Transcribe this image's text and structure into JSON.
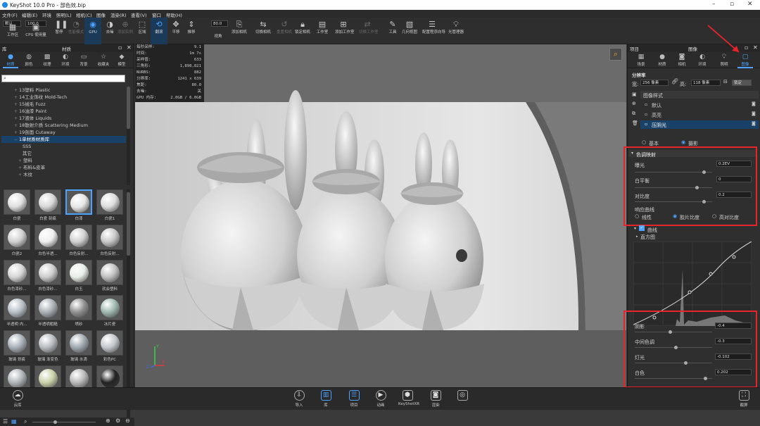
{
  "app": {
    "title": "KeyShot 10.0 Pro - 部色效.bip"
  },
  "menu": [
    "文件(F)",
    "编辑(E)",
    "环境",
    "照明(L)",
    "相机(C)",
    "图像",
    "渲染(R)",
    "查看(V)",
    "窗口",
    "帮助(H)"
  ],
  "toolbar": {
    "preset_value": "默认",
    "percent_value": "100.0",
    "quality_value": "80.0",
    "items": [
      {
        "label": "工作区",
        "icon": "workspace-icon"
      },
      {
        "label": "CPU 使用量",
        "icon": "cpu-icon"
      },
      {
        "label": "暂停",
        "icon": "pause-icon"
      },
      {
        "label": "性能模式",
        "icon": "performance-icon"
      },
      {
        "label": "GPU",
        "icon": "gpu-icon"
      },
      {
        "label": "去噪",
        "icon": "denoise-icon"
      },
      {
        "label": "添加实例",
        "icon": "add-instance-icon"
      },
      {
        "label": "区域",
        "icon": "region-icon"
      },
      {
        "label": "翻滚",
        "icon": "tumble-icon"
      },
      {
        "label": "平移",
        "icon": "pan-icon"
      },
      {
        "label": "推移",
        "icon": "dolly-icon"
      },
      {
        "label": "视角",
        "icon": "perspective-icon"
      },
      {
        "label": "添加相机",
        "icon": "add-camera-icon"
      },
      {
        "label": "切换相机",
        "icon": "switch-camera-icon"
      },
      {
        "label": "重置相机",
        "icon": "reset-camera-icon"
      },
      {
        "label": "锁定相机",
        "icon": "lock-camera-icon"
      },
      {
        "label": "工作室",
        "icon": "studio-icon"
      },
      {
        "label": "添加工作室",
        "icon": "add-studio-icon"
      },
      {
        "label": "切换工作室",
        "icon": "switch-studio-icon"
      },
      {
        "label": "工具",
        "icon": "tools-icon"
      },
      {
        "label": "几何视图",
        "icon": "geometry-view-icon"
      },
      {
        "label": "配置程序向导",
        "icon": "configurator-icon"
      },
      {
        "label": "光管理器",
        "icon": "light-manager-icon"
      }
    ]
  },
  "left_panel": {
    "header_left": "库",
    "header_center": "材质",
    "tabs": [
      "材质",
      "颜色",
      "纹理",
      "环境",
      "背景",
      "收藏夹",
      "模型"
    ],
    "tree": [
      "13塑料 Plastic",
      "14工业饰纹 Mold-Tech",
      "15绒毛 Fuzz",
      "16油漆 Paint",
      "17液体 Liquids",
      "18散射介质 Scattering Medium",
      "19剖面 Cutaway",
      "1单材质材质库",
      "SSS",
      "其它",
      "塑料",
      "布料&皮革",
      "木纹"
    ],
    "thumbs": [
      {
        "label": "白瓷",
        "c": "#e0e0e0"
      },
      {
        "label": "白瓷 刻痕",
        "c": "#d8d8d8"
      },
      {
        "label": "白漆",
        "c": "#e6e6e6"
      },
      {
        "label": "白瓷1",
        "c": "#dddddd"
      },
      {
        "label": "白瓷2",
        "c": "#d0d0d0"
      },
      {
        "label": "白色半透...",
        "c": "#eeeeee"
      },
      {
        "label": "白色反射...",
        "c": "#cfcfcf"
      },
      {
        "label": "白色反射...",
        "c": "#c8c8c8"
      },
      {
        "label": "白色漆砂...",
        "c": "#d6d6d6"
      },
      {
        "label": "白色漆砂...",
        "c": "#cdcdcd"
      },
      {
        "label": "白玉",
        "c": "#e8ede8"
      },
      {
        "label": "就会塑料",
        "c": "#c0c0c0"
      },
      {
        "label": "半透明 内...",
        "c": "#b8c0c8"
      },
      {
        "label": "半透明粗糙",
        "c": "#aab0b6"
      },
      {
        "label": "喷砂",
        "c": "#909090"
      },
      {
        "label": "冰片瓷",
        "c": "#9fb8b0"
      },
      {
        "label": "玻璃 划痕",
        "c": "#a8b0b8"
      },
      {
        "label": "玻璃 渐变色",
        "c": "#b8bcc0"
      },
      {
        "label": "玻璃 水滴",
        "c": "#a0a8b0"
      },
      {
        "label": "彩色PC",
        "c": "#c4c8cc"
      },
      {
        "label": "",
        "c": "#b0b4b8"
      },
      {
        "label": "",
        "c": "#c8d0a8"
      },
      {
        "label": "",
        "c": "#b8b8b8"
      },
      {
        "label": "",
        "c": "#222222"
      }
    ]
  },
  "stats": {
    "rows": [
      {
        "k": "每秒采样:",
        "v": "9.1"
      },
      {
        "k": "时间:",
        "v": "1m 7s"
      },
      {
        "k": "采样值:",
        "v": "633"
      },
      {
        "k": "三角形:",
        "v": "1,898,821"
      },
      {
        "k": "NURBS:",
        "v": "882"
      },
      {
        "k": "分辨率:",
        "v": "1241 x 639"
      },
      {
        "k": "焦距:",
        "v": "80.0"
      },
      {
        "k": "去噪:",
        "v": "关"
      },
      {
        "k": "GPU 内存:",
        "v": "2.0GB / 6.0GB"
      }
    ]
  },
  "right_panel": {
    "header_left": "项目",
    "header_center": "图像",
    "tabs": [
      "场景",
      "材质",
      "相机",
      "环境",
      "照明",
      "图像"
    ],
    "resolution_label": "分辨率",
    "width_label": "宽:",
    "width_value": "256 像素",
    "height_label": "高:",
    "height_value": "118 像素",
    "lock_label": "锁定",
    "image_styles_label": "图像样式",
    "styles": [
      "默认",
      "高亮",
      "压阴光"
    ],
    "mode_basic": "基本",
    "mode_photo": "摄影",
    "tone_section": "色调映射",
    "exposure_label": "曝光",
    "exposure_value": "0.2EV",
    "white_label": "白平衡",
    "white_value": "0",
    "contrast_label": "对比度",
    "contrast_value": "0.2",
    "response_label": "响应曲线",
    "resp_linear": "线性",
    "resp_film": "胶片比度",
    "resp_high": "高对比度",
    "curve_section": "曲线",
    "histogram_label": "直方图",
    "shadows_label": "阴影",
    "shadows_value": "-0.4",
    "midtones_label": "中间色调",
    "midtones_value": "-0.3",
    "highlights_label": "灯光",
    "highlights_value": "-0.102",
    "whites_label": "白色",
    "whites_value": "0.202"
  },
  "bottom": {
    "left_label": "云库",
    "right_label": "截屏",
    "items": [
      {
        "label": "导入",
        "icon": "import-icon"
      },
      {
        "label": "库",
        "icon": "library-icon"
      },
      {
        "label": "项目",
        "icon": "project-icon"
      },
      {
        "label": "动画",
        "icon": "animation-icon"
      },
      {
        "label": "KeyShotXR",
        "icon": "keyshotxr-icon"
      },
      {
        "label": "渲染",
        "icon": "render-icon"
      },
      {
        "label": "",
        "icon": "camera-icon"
      }
    ]
  },
  "colors": {
    "accent": "#4da3ff",
    "highlight_box": "#e8242b",
    "selection": "#1a4168"
  }
}
